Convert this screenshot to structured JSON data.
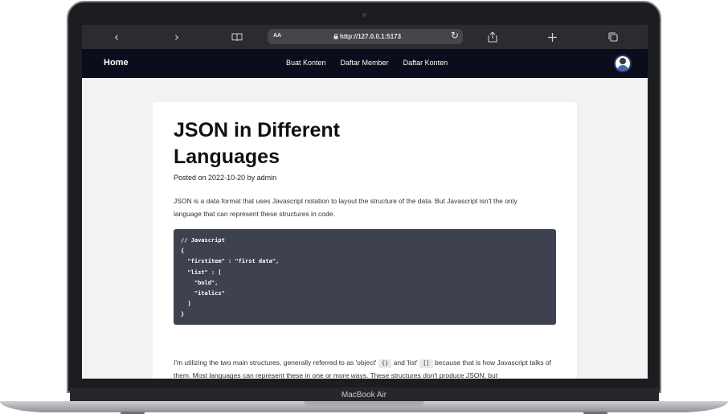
{
  "browser": {
    "back_icon": "chevron-left-icon",
    "forward_icon": "chevron-right-icon",
    "reader_icon": "book-icon",
    "text_size": "AA",
    "url": "http://127.0.0.1:5173",
    "share_icon": "share-icon",
    "new_tab_icon": "plus-icon",
    "tabs_icon": "tabs-icon"
  },
  "nav": {
    "home": "Home",
    "links": [
      "Buat Konten",
      "Daftar Member",
      "Daftar Konten"
    ]
  },
  "article": {
    "title": "JSON in Different Languages",
    "posted_on_prefix": "Posted on",
    "date": "2022-10-20",
    "by": "by",
    "author": "admin",
    "intro": "JSON is a data format that uses Javascript notation to layout the structure of the data. But Javascript isn't the only language that can represent these structures in code.",
    "code": "// Javascript\n{\n  \"firstitem\" : \"first data\",\n  \"list\" : [\n    \"bold\",\n    \"italics\"\n  ]\n}",
    "para2_a": "I'm utilizing the two main structures, generally referred to as 'object'",
    "para2_obj": "{}",
    "para2_b": "and 'list'",
    "para2_list": "[]",
    "para2_c": "because that is how Javascript talks of them. Most languages can represent these in one or more ways. These structures don't produce JSON, but"
  },
  "device": {
    "model": "MacBook Air"
  }
}
